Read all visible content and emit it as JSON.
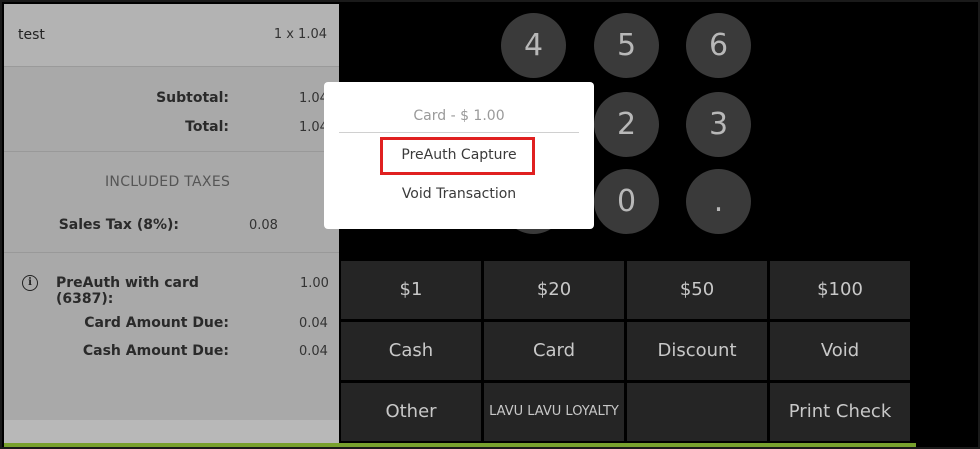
{
  "receipt": {
    "item_name": "test",
    "item_qty": "1 x 1.04",
    "subtotal_label": "Subtotal:",
    "subtotal_value": "1.04",
    "total_label": "Total:",
    "total_value": "1.04",
    "taxes_heading": "INCLUDED TAXES",
    "sales_tax_label": "Sales Tax (8%):",
    "sales_tax_value": "0.08",
    "info_icon": "i",
    "preauth_label": "PreAuth with card (6387):",
    "preauth_value": "1.00",
    "card_due_label": "Card Amount Due:",
    "card_due_value": "0.04",
    "cash_due_label": "Cash Amount Due:",
    "cash_due_value": "0.04"
  },
  "numpad": {
    "k4": "4",
    "k5": "5",
    "k6": "6",
    "k2": "2",
    "k3": "3",
    "k0": "0",
    "kdot": "."
  },
  "buttons": {
    "b1": "$1",
    "b20": "$20",
    "b50": "$50",
    "b100": "$100",
    "cash": "Cash",
    "card": "Card",
    "discount": "Discount",
    "void": "Void",
    "other": "Other",
    "loyalty": "LAVU LAVU LOYALTY",
    "blank": "",
    "print_check": "Print Check"
  },
  "modal": {
    "title": "Card - $ 1.00",
    "option1": "PreAuth Capture",
    "option2": "Void Transaction"
  },
  "colors": {
    "accent_green": "#78a12d",
    "highlight_red": "#e02020"
  }
}
